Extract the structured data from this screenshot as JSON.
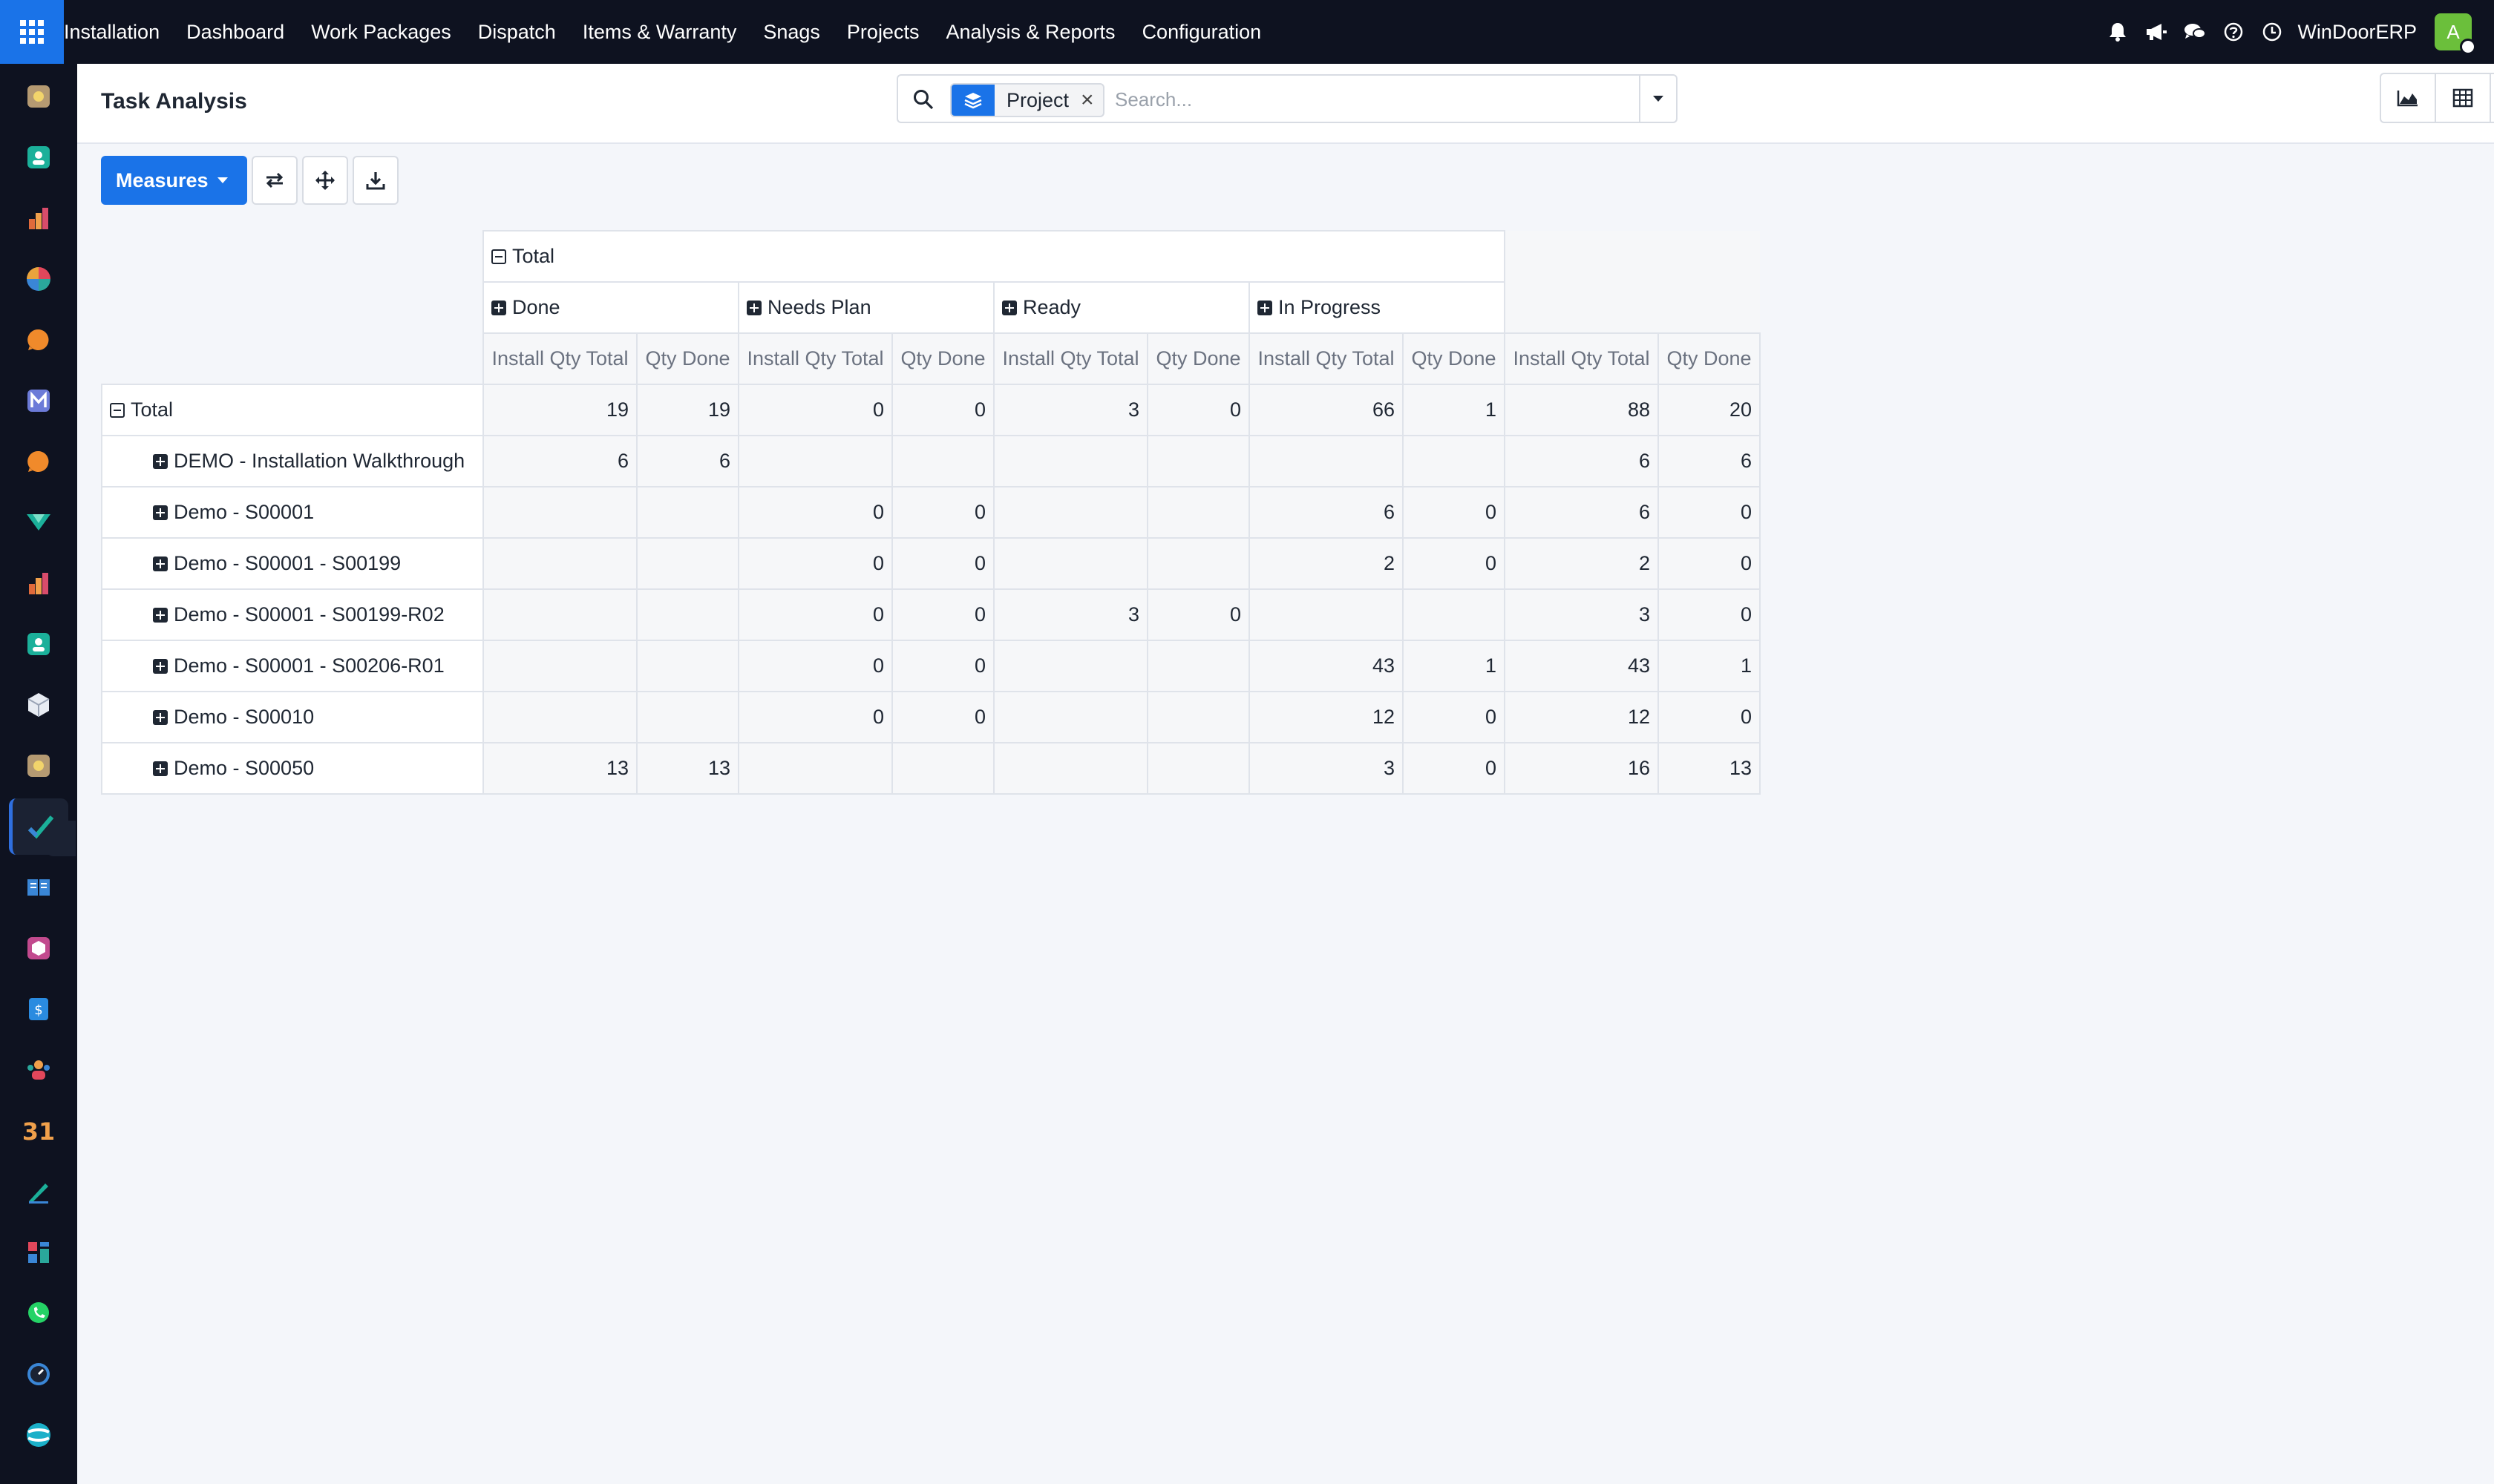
{
  "app": {
    "menu": [
      "Installation",
      "Dashboard",
      "Work Packages",
      "Dispatch",
      "Items & Warranty",
      "Snags",
      "Projects",
      "Analysis & Reports",
      "Configuration"
    ],
    "company": "WinDoorERP",
    "avatar_initial": "A",
    "colors": {
      "topbar": "#0e1220",
      "primary": "#1a73e8",
      "avatar": "#6bbf3b"
    }
  },
  "control": {
    "title": "Task Analysis",
    "facet_label": "Project",
    "search_placeholder": "Search...",
    "measures_label": "Measures"
  },
  "pivot": {
    "col_total": "Total",
    "groups": [
      "Done",
      "Needs Plan",
      "Ready",
      "In Progress"
    ],
    "measures": [
      "Install Qty Total",
      "Qty Done"
    ],
    "row_total_label": "Total",
    "total_row": [
      "19",
      "19",
      "0",
      "0",
      "3",
      "0",
      "66",
      "1",
      "88",
      "20"
    ],
    "rows": [
      {
        "label": "DEMO - Installation Walkthrough",
        "values": [
          "6",
          "6",
          "",
          "",
          "",
          "",
          "",
          "",
          "6",
          "6"
        ]
      },
      {
        "label": "Demo - S00001",
        "values": [
          "",
          "",
          "0",
          "0",
          "",
          "",
          "6",
          "0",
          "6",
          "0"
        ]
      },
      {
        "label": "Demo - S00001 - S00199",
        "values": [
          "",
          "",
          "0",
          "0",
          "",
          "",
          "2",
          "0",
          "2",
          "0"
        ]
      },
      {
        "label": "Demo - S00001 - S00199-R02",
        "values": [
          "",
          "",
          "0",
          "0",
          "3",
          "0",
          "",
          "",
          "3",
          "0"
        ]
      },
      {
        "label": "Demo - S00001 - S00206-R01",
        "values": [
          "",
          "",
          "0",
          "0",
          "",
          "",
          "43",
          "1",
          "43",
          "1"
        ]
      },
      {
        "label": "Demo - S00010",
        "values": [
          "",
          "",
          "0",
          "0",
          "",
          "",
          "12",
          "0",
          "12",
          "0"
        ]
      },
      {
        "label": "Demo - S00050",
        "values": [
          "13",
          "13",
          "",
          "",
          "",
          "",
          "3",
          "0",
          "16",
          "13"
        ]
      }
    ]
  }
}
